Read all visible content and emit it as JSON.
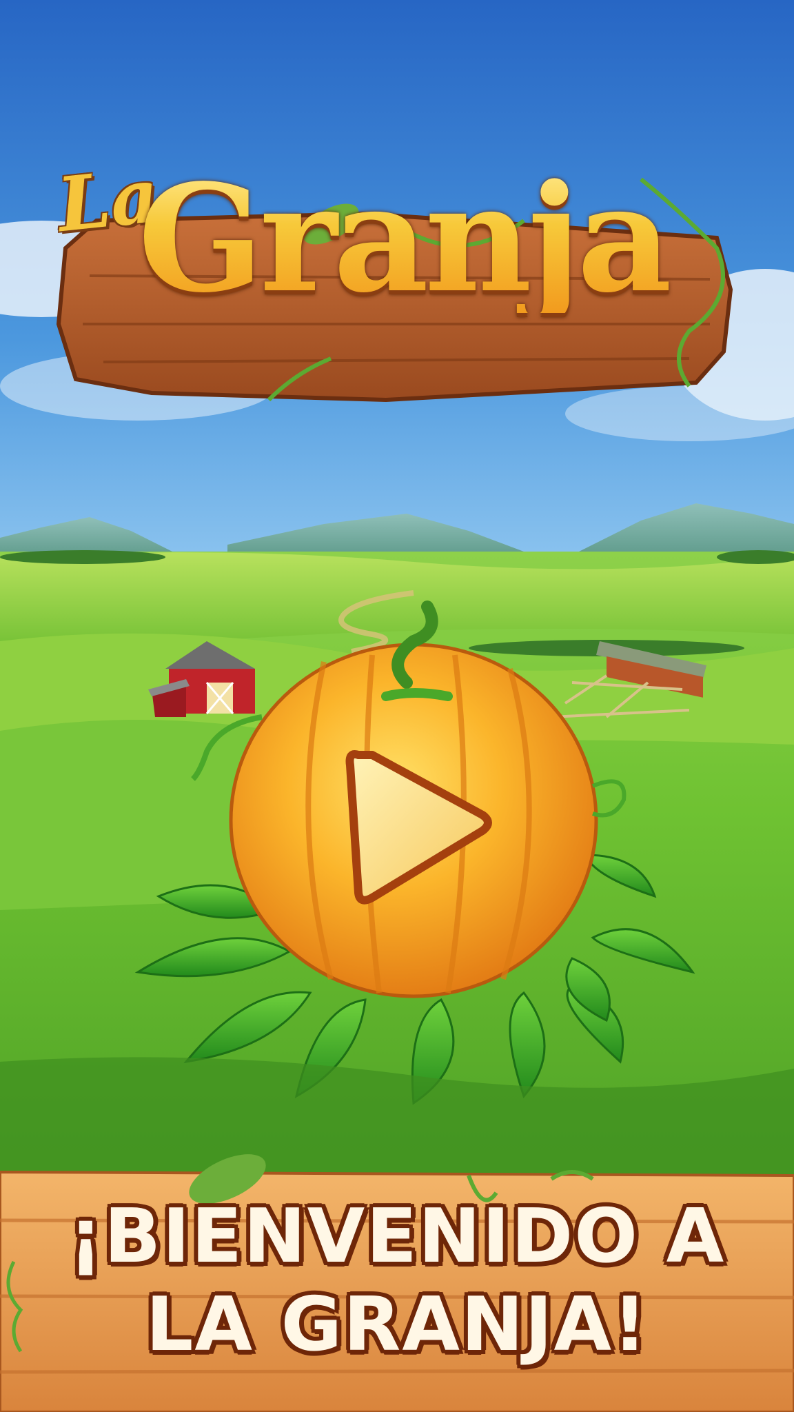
{
  "logo": {
    "la": "La",
    "title": "Granja"
  },
  "welcome": {
    "line1": "¡BIENVENIDO A",
    "line2": "LA GRANJA!"
  },
  "play_button": {
    "icon": "play-icon"
  },
  "colors": {
    "sky_top": "#2b6fc8",
    "sky_bottom": "#79b8ea",
    "grass": "#6cc331",
    "pumpkin": "#f7a21c",
    "wood": "#e89a4c",
    "text_outline": "#6e2608",
    "text_fill": "#fff7e6",
    "logo_gold": "#f7c93a"
  }
}
